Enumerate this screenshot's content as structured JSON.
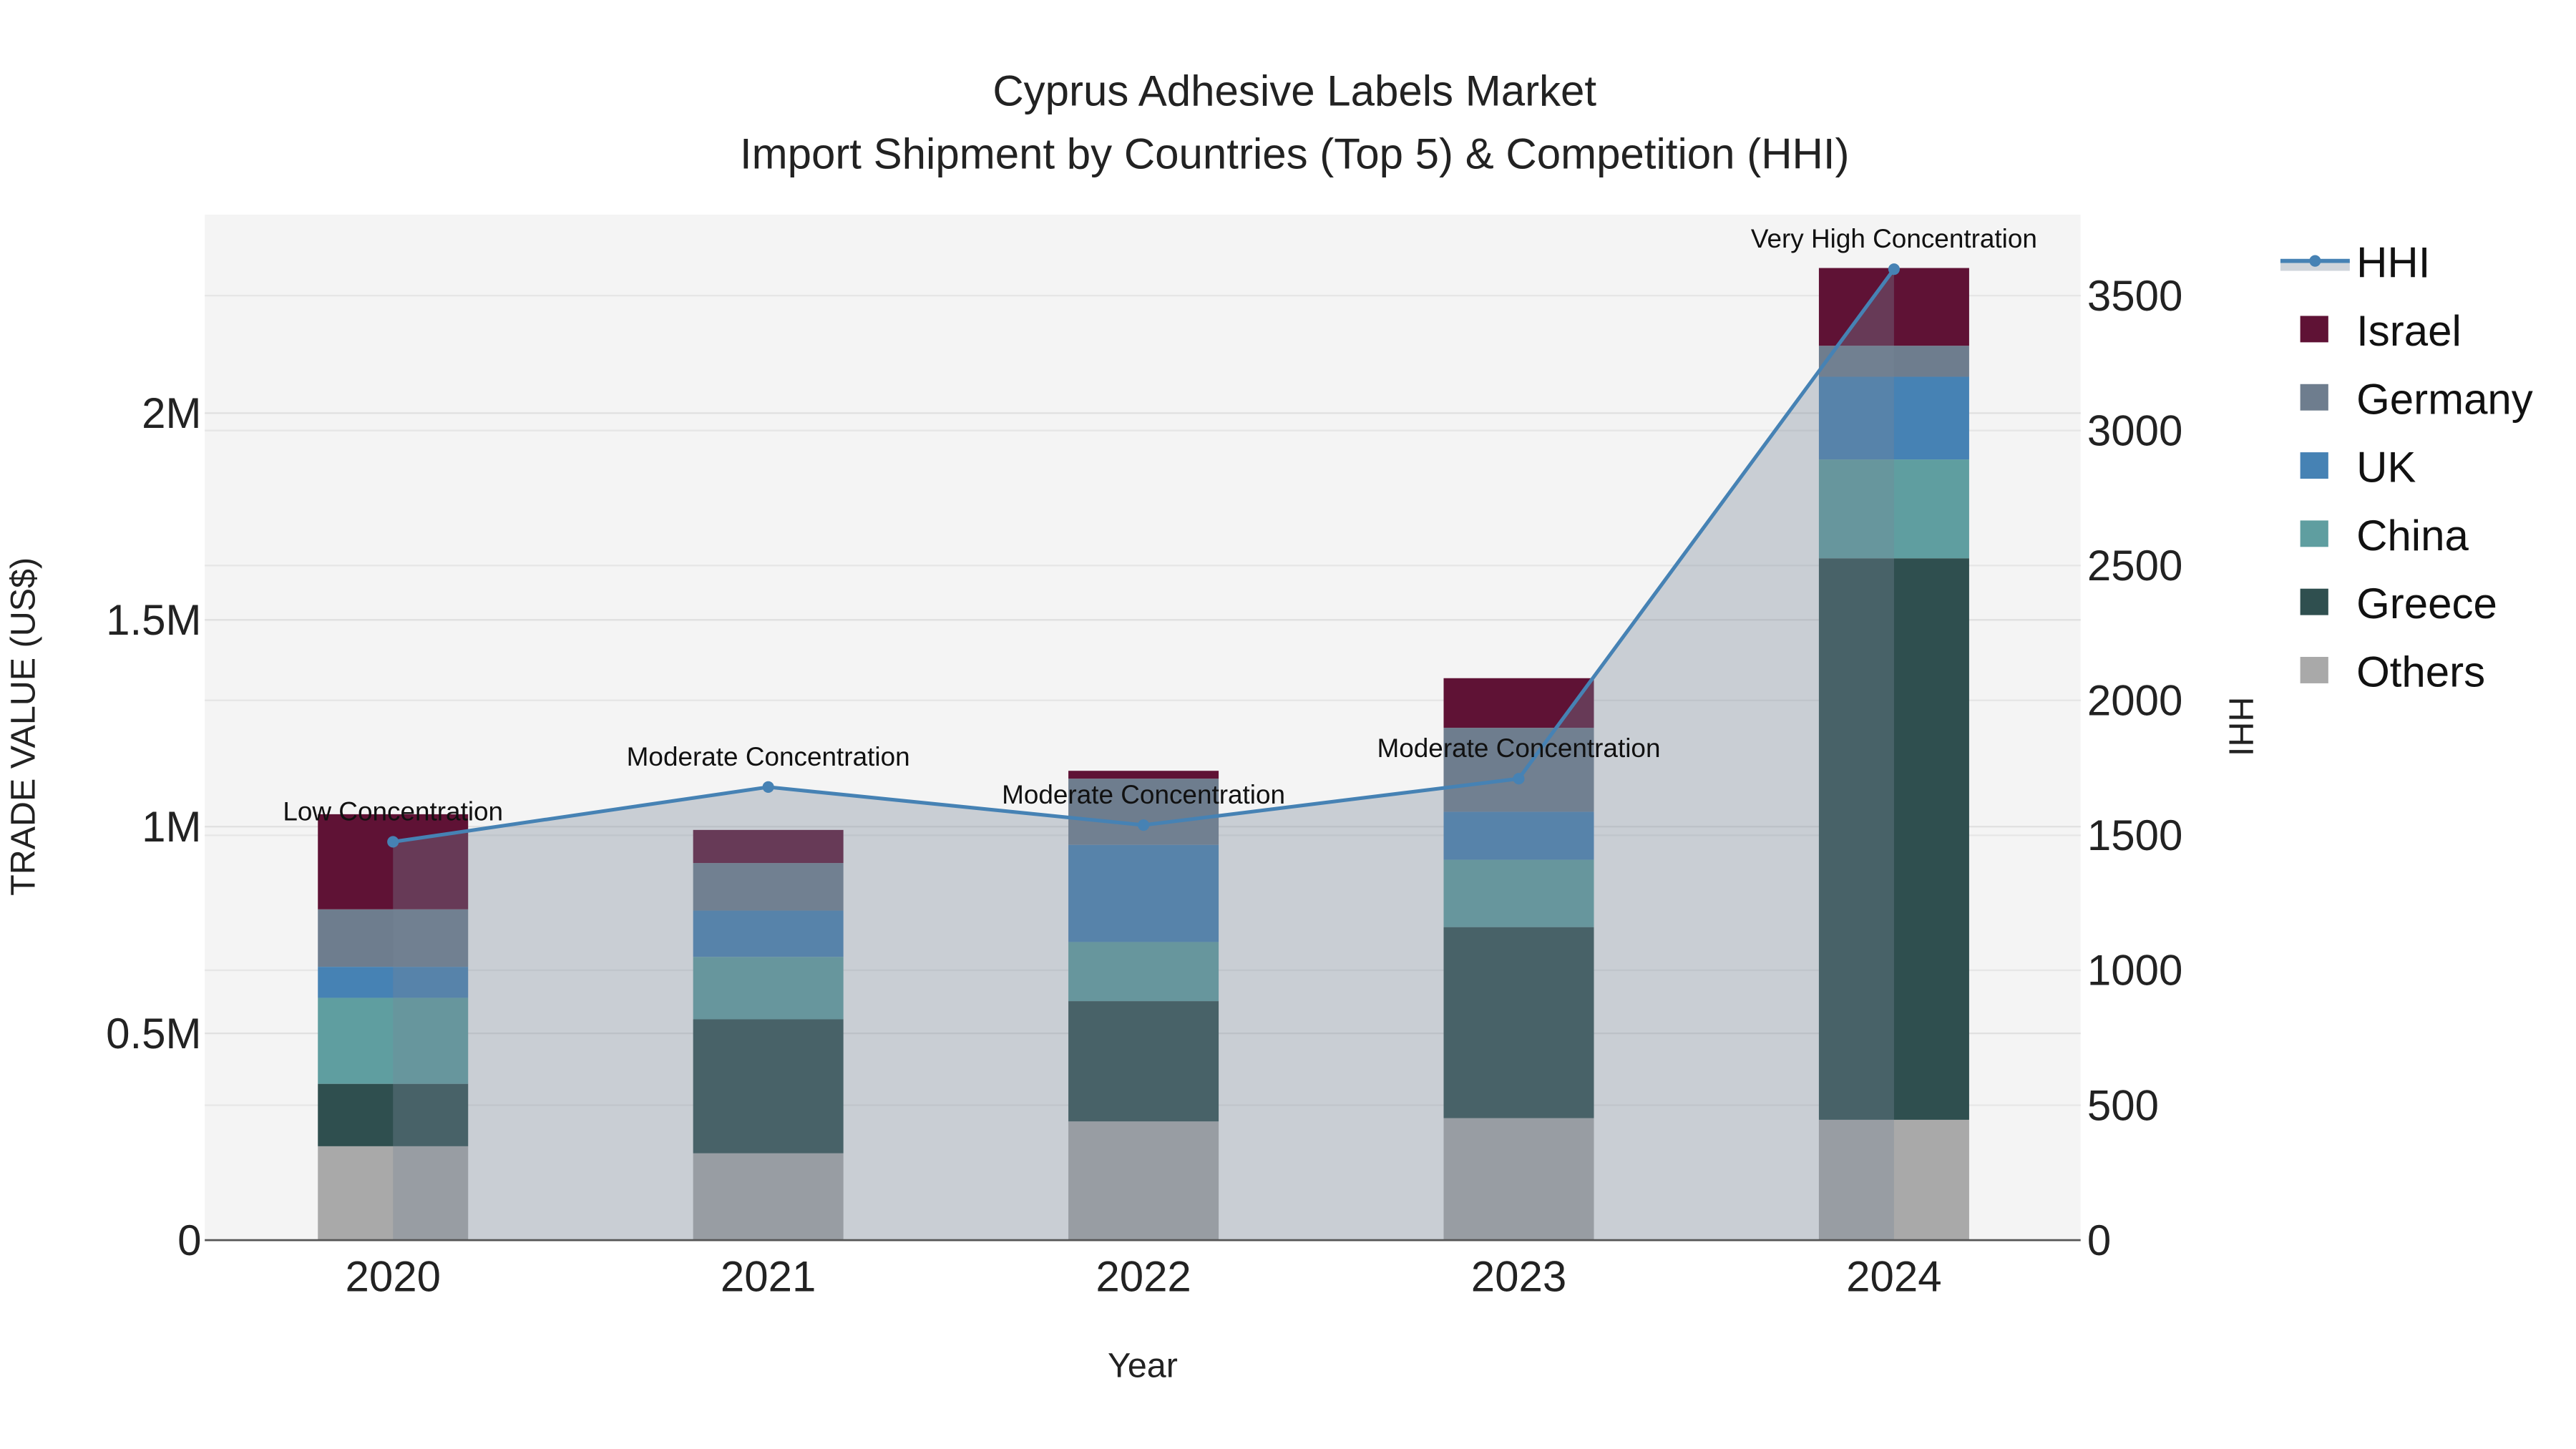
{
  "chart_data": {
    "type": "bar",
    "title": "Cyprus Adhesive Labels Market",
    "subtitle": "Import Shipment by Countries (Top 5) & Competition (HHI)",
    "xlabel": "Year",
    "ylabel": "TRADE VALUE (US$)",
    "y2label": "HHI",
    "categories": [
      "2020",
      "2021",
      "2022",
      "2023",
      "2024"
    ],
    "ylim": [
      0,
      2480000
    ],
    "y2lim": [
      0,
      3800
    ],
    "yticks": [
      0,
      500000,
      1000000,
      1500000,
      2000000
    ],
    "ytick_labels": [
      "0",
      "0.5M",
      "1M",
      "1.5M",
      "2M"
    ],
    "y2ticks": [
      0,
      500,
      1000,
      1500,
      2000,
      2500,
      3000,
      3500
    ],
    "y2tick_labels": [
      "0",
      "500",
      "1000",
      "1500",
      "2000",
      "2500",
      "3000",
      "3500"
    ],
    "stacked": true,
    "series": [
      {
        "name": "Others",
        "color": "#a9a9a9",
        "values": [
          227000,
          210000,
          287000,
          295000,
          291000
        ]
      },
      {
        "name": "Greece",
        "color": "#2f4f4f",
        "values": [
          151000,
          324000,
          291000,
          462000,
          1358000
        ]
      },
      {
        "name": "China",
        "color": "#5f9ea0",
        "values": [
          208000,
          151000,
          143000,
          163000,
          239000
        ]
      },
      {
        "name": "UK",
        "color": "#4682b4",
        "values": [
          75000,
          112000,
          235000,
          116000,
          200000
        ]
      },
      {
        "name": "Germany",
        "color": "#6e7d8e",
        "values": [
          139000,
          115000,
          160000,
          203000,
          75000
        ]
      },
      {
        "name": "Israel",
        "color": "#5f1235",
        "values": [
          230000,
          80000,
          19000,
          120000,
          188000
        ]
      }
    ],
    "line": {
      "name": "HHI",
      "color": "#4682b4",
      "values": [
        1476,
        1679,
        1538,
        1710,
        3598
      ],
      "annotations": [
        "Low Concentration",
        "Moderate Concentration",
        "Moderate Concentration",
        "Moderate Concentration",
        "Very High Concentration"
      ]
    },
    "legend": {
      "placement": "right",
      "entries": [
        "HHI",
        "Israel",
        "Germany",
        "UK",
        "China",
        "Greece",
        "Others"
      ]
    },
    "grid": true
  }
}
